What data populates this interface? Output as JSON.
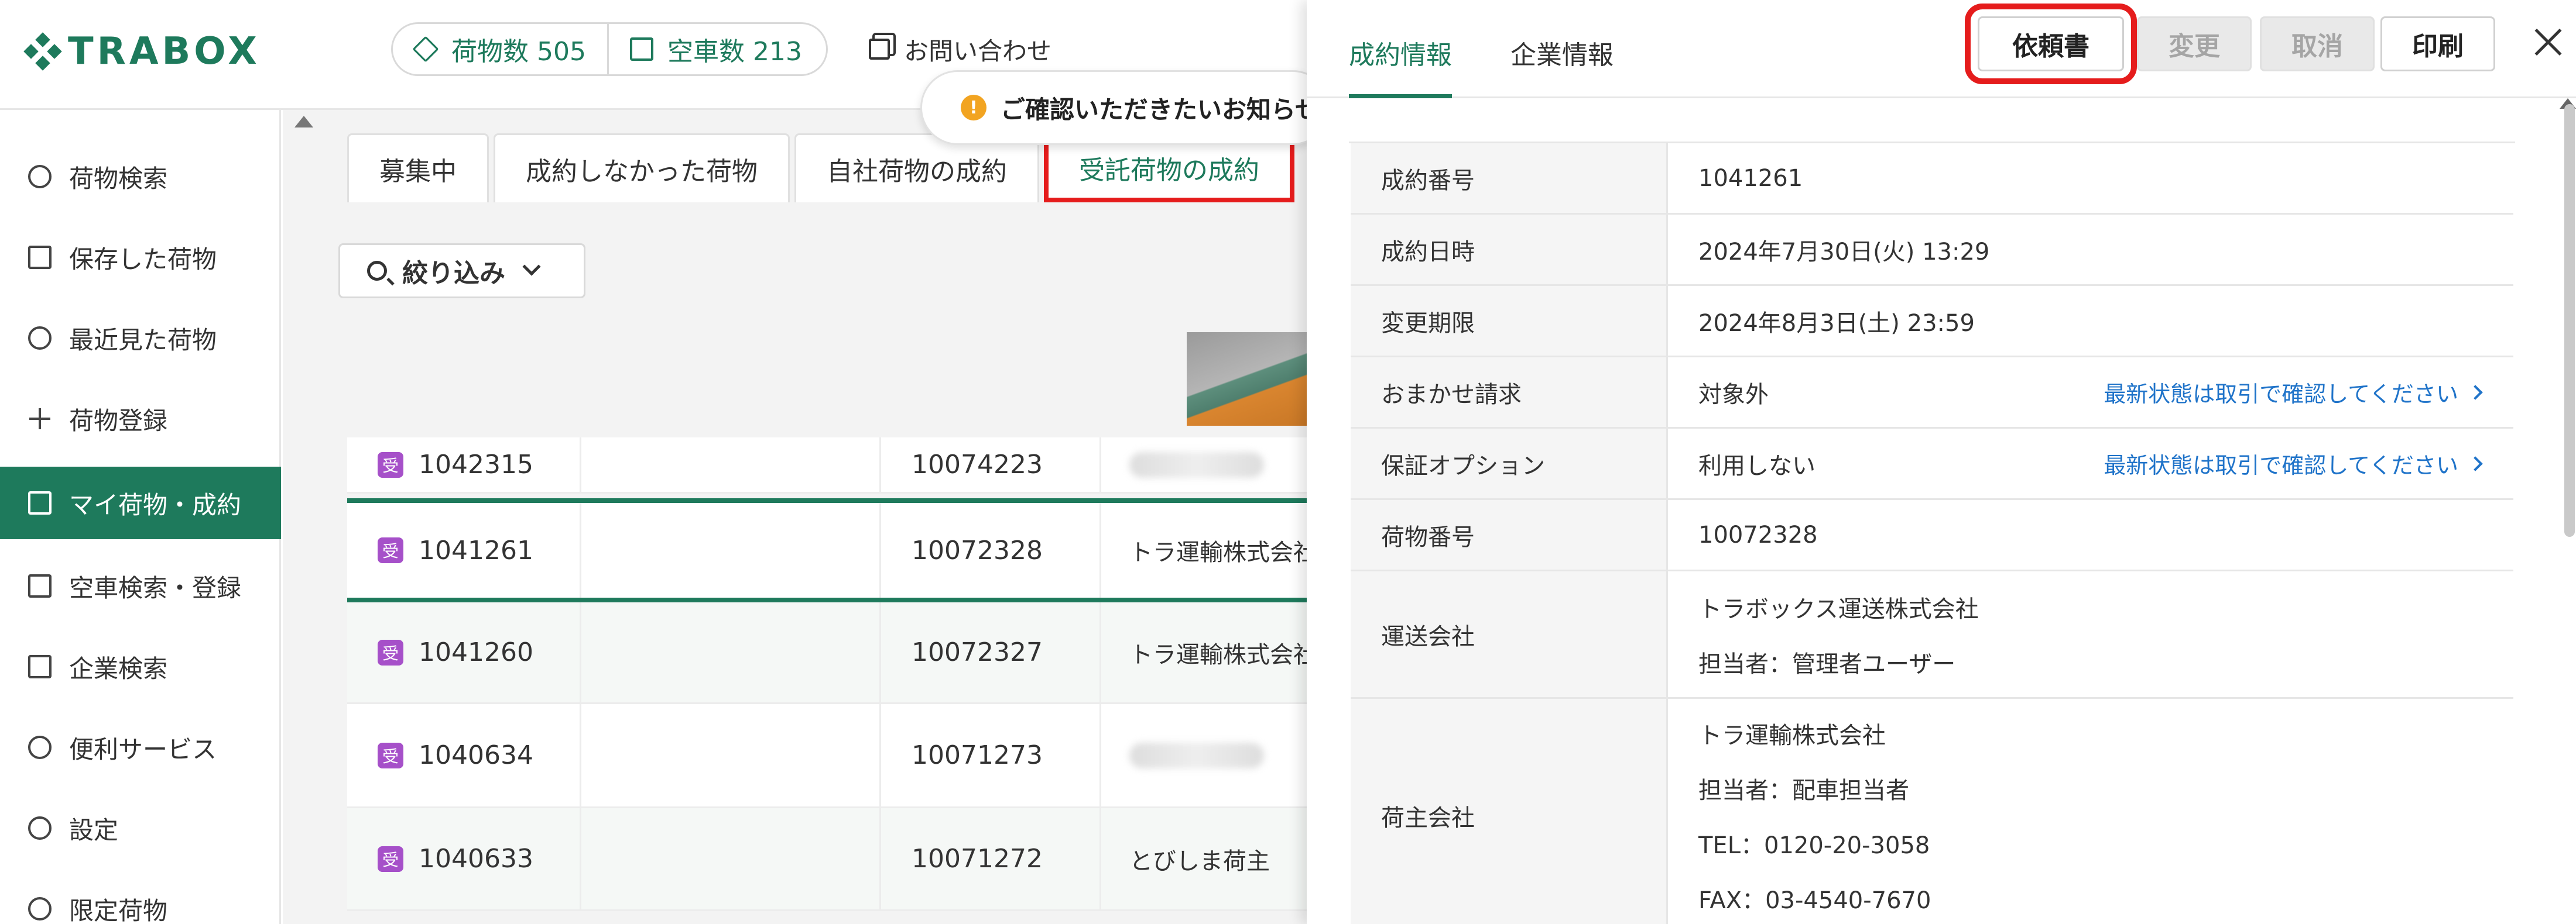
{
  "header": {
    "logo": "TRABOX",
    "stats": [
      {
        "label": "荷物数 505",
        "icon": "cube-icon"
      },
      {
        "label": "空車数 213",
        "icon": "truck-icon"
      }
    ],
    "contact": "お問い合わせ"
  },
  "sidebar": {
    "items": [
      {
        "label": "荷物検索",
        "icon": "search-icon"
      },
      {
        "label": "保存した荷物",
        "icon": "bookmark-icon"
      },
      {
        "label": "最近見た荷物",
        "icon": "clock-icon"
      },
      {
        "label": "荷物登録",
        "icon": "plus-icon"
      },
      {
        "label": "マイ荷物・成約",
        "icon": "cube-icon",
        "active": true
      },
      {
        "label": "空車検索・登録",
        "icon": "truck-icon"
      },
      {
        "label": "企業検索",
        "icon": "building-icon"
      },
      {
        "label": "便利サービス",
        "icon": "network-icon"
      },
      {
        "label": "設定",
        "icon": "gear-icon"
      },
      {
        "label": "限定荷物",
        "icon": "users-icon"
      }
    ]
  },
  "main": {
    "tabs": [
      "募集中",
      "成約しなかった荷物",
      "自社荷物の成約",
      "受託荷物の成約"
    ],
    "active_tab": "受託荷物の成約",
    "filter_label": "絞り込み",
    "notice": "ご確認いただきたいお知らせが",
    "rows": [
      {
        "badge": "受",
        "id": "1042315",
        "cargo": "10074223",
        "company": ""
      },
      {
        "badge": "受",
        "id": "1041261",
        "cargo": "10072328",
        "company": "トラ運輸株式会社"
      },
      {
        "badge": "受",
        "id": "1041260",
        "cargo": "10072327",
        "company": "トラ運輸株式会社"
      },
      {
        "badge": "受",
        "id": "1040634",
        "cargo": "10071273",
        "company": ""
      },
      {
        "badge": "受",
        "id": "1040633",
        "cargo": "10071272",
        "company": "とびしま荷主"
      }
    ]
  },
  "drawer": {
    "tabs": [
      "成約情報",
      "企業情報"
    ],
    "buttons": {
      "request": "依頼書",
      "change": "変更",
      "cancel": "取消",
      "print": "印刷"
    },
    "link_text": "最新状態は取引で確認してください",
    "fields": [
      {
        "label": "成約番号",
        "value": "1041261"
      },
      {
        "label": "成約日時",
        "value": "2024年7月30日(火) 13:29"
      },
      {
        "label": "変更期限",
        "value": "2024年8月3日(土) 23:59"
      },
      {
        "label": "おまかせ請求",
        "value": "対象外"
      },
      {
        "label": "保証オプション",
        "value": "利用しない"
      },
      {
        "label": "荷物番号",
        "value": "10072328"
      }
    ],
    "carrier": {
      "label": "運送会社",
      "lines": [
        "トラボックス運送株式会社",
        "担当者：管理者ユーザー"
      ]
    },
    "shipper": {
      "label": "荷主会社",
      "lines": [
        "トラ運輸株式会社",
        "担当者：配車担当者",
        "TEL：0120-20-3058",
        "FAX：03-4540-7670"
      ]
    }
  },
  "colors": {
    "brand": "#1e7a5c",
    "highlight": "#e51c1c",
    "badge": "#a650c9",
    "link": "#1f73c9"
  }
}
